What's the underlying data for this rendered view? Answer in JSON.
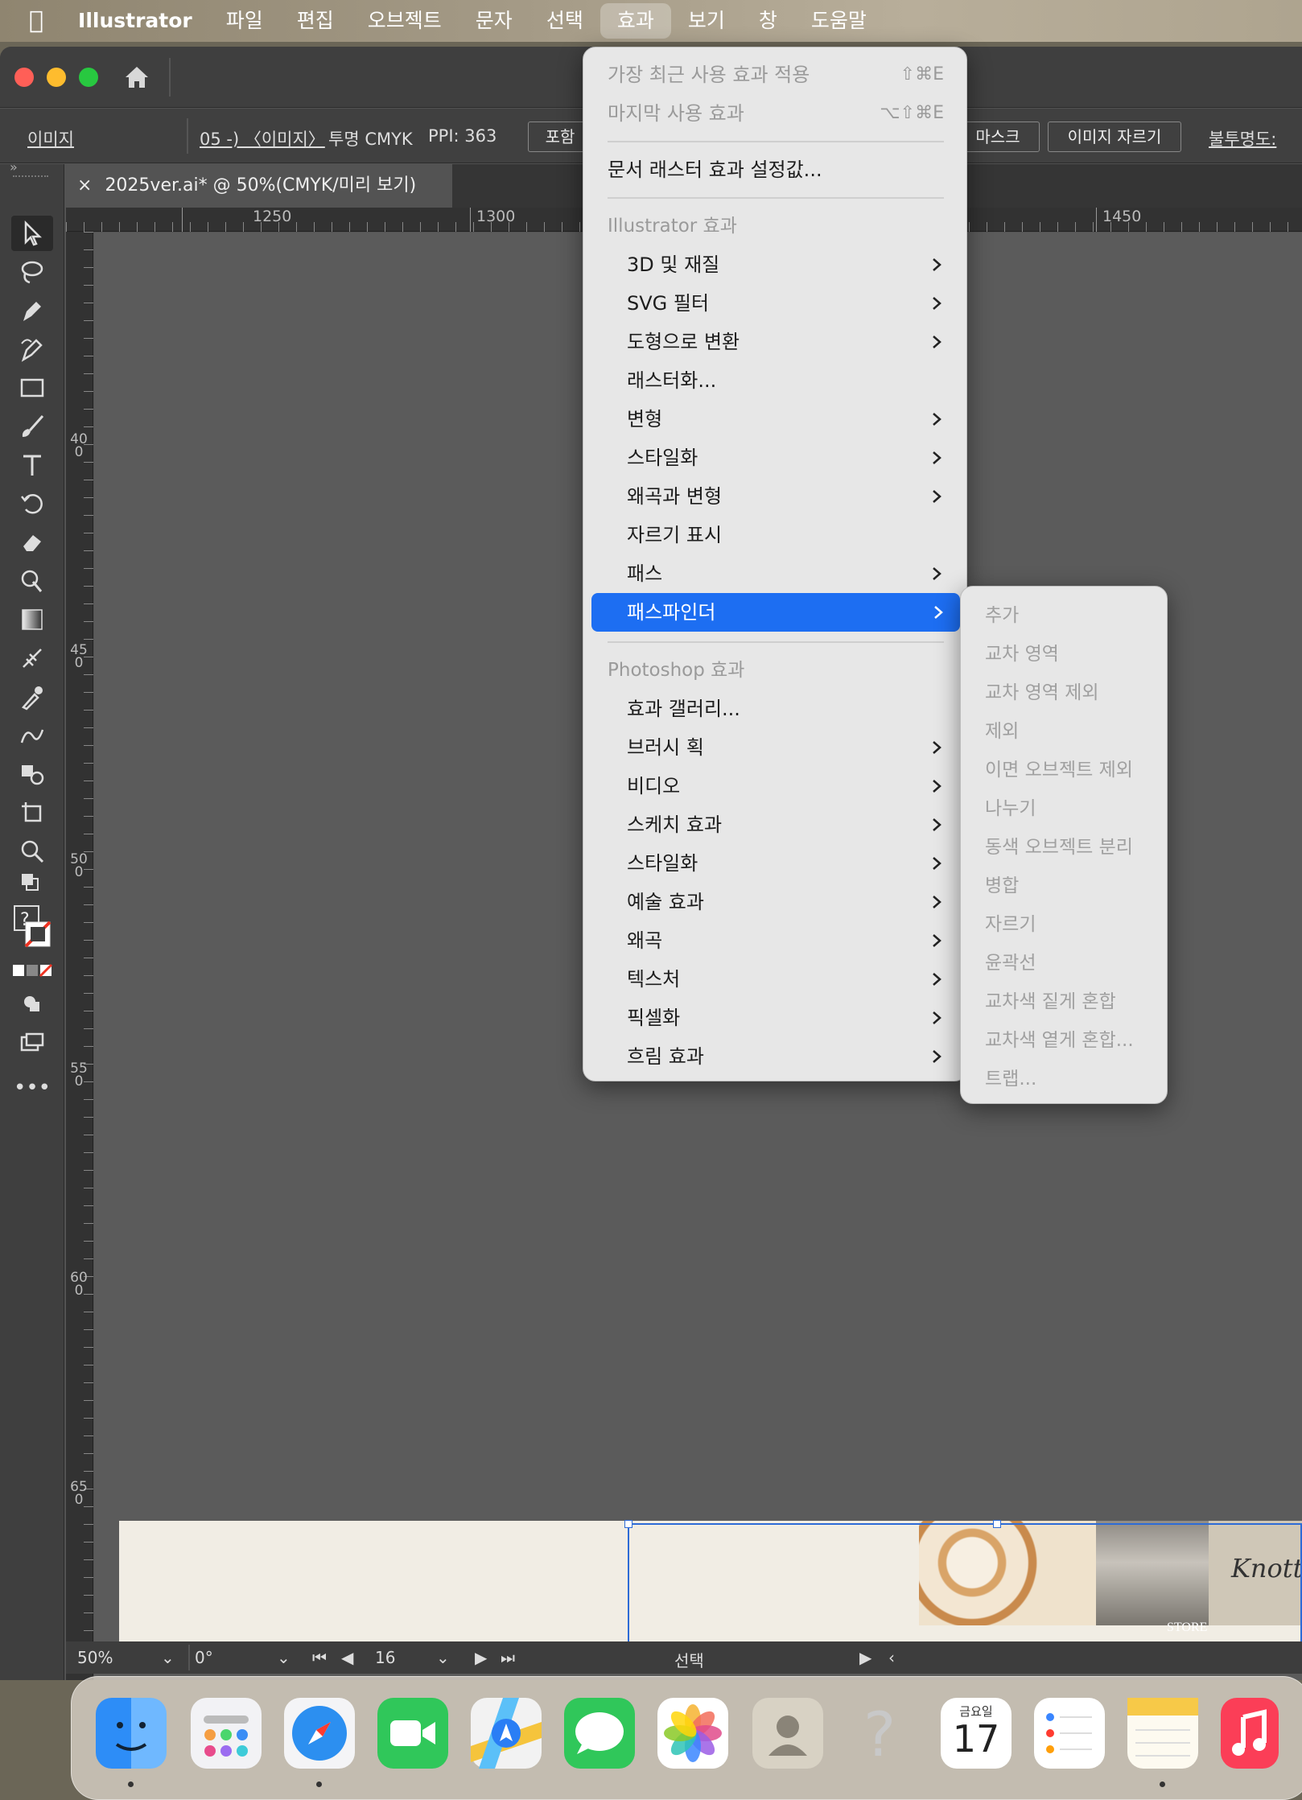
{
  "menubar": {
    "apple": "",
    "app_name": "Illustrator",
    "items": [
      "파일",
      "편집",
      "오브젝트",
      "문자",
      "선택",
      "효과",
      "보기",
      "창",
      "도움말"
    ],
    "active_item": "효과"
  },
  "control_bar": {
    "type_label": "이미지",
    "link_name": "05 -) 〈이미지〉",
    "color_mode": "투명 CMYK",
    "ppi": "PPI: 363",
    "embed_button": "포함",
    "mask_button": "마스크",
    "crop_button": "이미지 자르기",
    "opacity_label": "불투명도:"
  },
  "document_tab": {
    "close": "×",
    "title": "2025ver.ai* @ 50%(CMYK/미리 보기)"
  },
  "ruler": {
    "h_labels": [
      "1250",
      "1300",
      "1450"
    ],
    "v_labels": [
      "400",
      "450",
      "500",
      "550",
      "600",
      "650"
    ]
  },
  "effect_menu": {
    "top_items": [
      {
        "label": "가장 최근 사용 효과 적용",
        "shortcut": "⇧⌘E",
        "disabled": true
      },
      {
        "label": "마지막 사용 효과",
        "shortcut": "⌥⇧⌘E",
        "disabled": true
      }
    ],
    "doc_raster": "문서 래스터 효과 설정값...",
    "illustrator_header": "Illustrator 효과",
    "illustrator_items": [
      {
        "label": "3D 및 재질",
        "submenu": true
      },
      {
        "label": "SVG 필터",
        "submenu": true
      },
      {
        "label": "도형으로 변환",
        "submenu": true
      },
      {
        "label": "래스터화...",
        "submenu": false
      },
      {
        "label": "변형",
        "submenu": true
      },
      {
        "label": "스타일화",
        "submenu": true
      },
      {
        "label": "왜곡과 변형",
        "submenu": true
      },
      {
        "label": "자르기 표시",
        "submenu": false
      },
      {
        "label": "패스",
        "submenu": true
      },
      {
        "label": "패스파인더",
        "submenu": true,
        "highlighted": true
      }
    ],
    "photoshop_header": "Photoshop 효과",
    "photoshop_items": [
      {
        "label": "효과 갤러리...",
        "submenu": false
      },
      {
        "label": "브러시 획",
        "submenu": true
      },
      {
        "label": "비디오",
        "submenu": true
      },
      {
        "label": "스케치 효과",
        "submenu": true
      },
      {
        "label": "스타일화",
        "submenu": true
      },
      {
        "label": "예술 효과",
        "submenu": true
      },
      {
        "label": "왜곡",
        "submenu": true
      },
      {
        "label": "텍스처",
        "submenu": true
      },
      {
        "label": "픽셀화",
        "submenu": true
      },
      {
        "label": "흐림 효과",
        "submenu": true
      }
    ]
  },
  "pathfinder_submenu": {
    "items": [
      "추가",
      "교차 영역",
      "교차 영역 제외",
      "제외",
      "이면 오브젝트 제외",
      "나누기",
      "동색 오브젝트 분리",
      "병합",
      "자르기",
      "윤곽선",
      "교차색 짙게 혼합",
      "교차색 옅게 혼합...",
      "트랩..."
    ]
  },
  "status_bar": {
    "zoom": "50%",
    "rotation": "0°",
    "artboard": "16",
    "tool": "선택"
  },
  "artwork": {
    "image_text_1": "Knott",
    "image_text_2": "STORE"
  },
  "dock": {
    "calendar_day": "금요일",
    "calendar_date": "17"
  }
}
